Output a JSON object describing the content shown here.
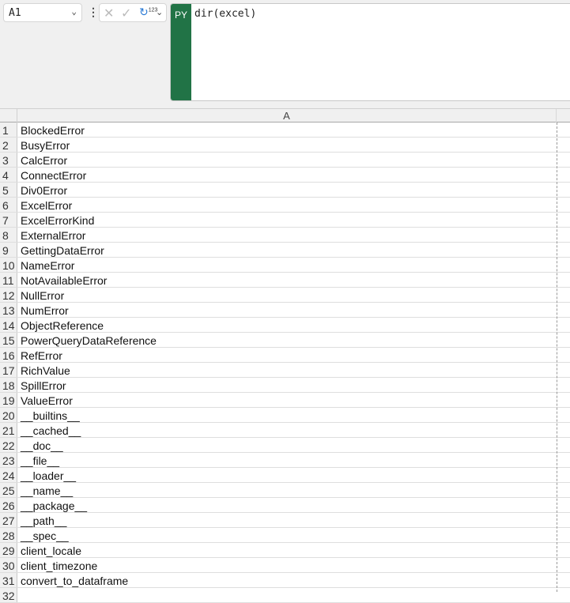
{
  "name_box": "A1",
  "formula_bar": {
    "badge": "PY",
    "formula": "dir(excel)"
  },
  "column_header": "A",
  "rows": [
    {
      "n": "1",
      "v": "BlockedError"
    },
    {
      "n": "2",
      "v": "BusyError"
    },
    {
      "n": "3",
      "v": "CalcError"
    },
    {
      "n": "4",
      "v": "ConnectError"
    },
    {
      "n": "5",
      "v": "Div0Error"
    },
    {
      "n": "6",
      "v": "ExcelError"
    },
    {
      "n": "7",
      "v": "ExcelErrorKind"
    },
    {
      "n": "8",
      "v": "ExternalError"
    },
    {
      "n": "9",
      "v": "GettingDataError"
    },
    {
      "n": "10",
      "v": "NameError"
    },
    {
      "n": "11",
      "v": "NotAvailableError"
    },
    {
      "n": "12",
      "v": "NullError"
    },
    {
      "n": "13",
      "v": "NumError"
    },
    {
      "n": "14",
      "v": "ObjectReference"
    },
    {
      "n": "15",
      "v": "PowerQueryDataReference"
    },
    {
      "n": "16",
      "v": "RefError"
    },
    {
      "n": "17",
      "v": "RichValue"
    },
    {
      "n": "18",
      "v": "SpillError"
    },
    {
      "n": "19",
      "v": "ValueError"
    },
    {
      "n": "20",
      "v": "__builtins__"
    },
    {
      "n": "21",
      "v": "__cached__"
    },
    {
      "n": "22",
      "v": "__doc__"
    },
    {
      "n": "23",
      "v": "__file__"
    },
    {
      "n": "24",
      "v": "__loader__"
    },
    {
      "n": "25",
      "v": "__name__"
    },
    {
      "n": "26",
      "v": "__package__"
    },
    {
      "n": "27",
      "v": "__path__"
    },
    {
      "n": "28",
      "v": "__spec__"
    },
    {
      "n": "29",
      "v": "client_locale"
    },
    {
      "n": "30",
      "v": "client_timezone"
    },
    {
      "n": "31",
      "v": "convert_to_dataframe"
    },
    {
      "n": "32",
      "v": ""
    }
  ]
}
